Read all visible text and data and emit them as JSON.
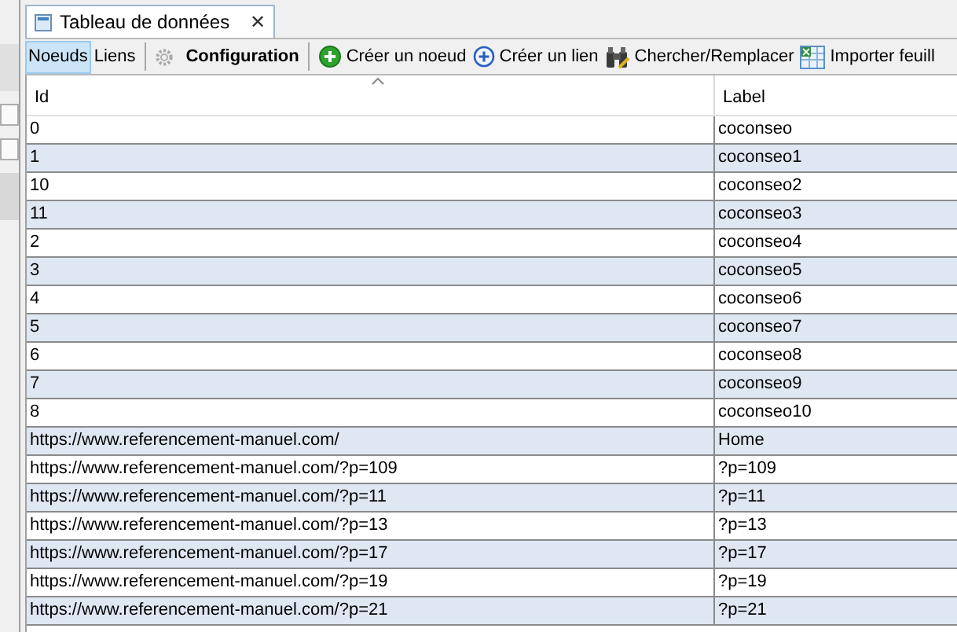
{
  "tab": {
    "title": "Tableau de données",
    "close": "✕"
  },
  "toolbar": {
    "views": [
      {
        "label": "Noeuds",
        "selected": true
      },
      {
        "label": "Liens",
        "selected": false
      }
    ],
    "actions": [
      {
        "kind": "gear",
        "label": "Configuration"
      },
      {
        "kind": "add-node",
        "label": "Créer un noeud"
      },
      {
        "kind": "add-link",
        "label": "Créer un lien"
      },
      {
        "kind": "binoculars",
        "label": "Chercher/Remplacer"
      },
      {
        "kind": "sheet",
        "label": "Importer feuill"
      }
    ]
  },
  "table": {
    "columns": [
      {
        "label": "Id",
        "sorted": true
      },
      {
        "label": "Label",
        "sorted": false
      }
    ],
    "rows": [
      [
        "0",
        "coconseo"
      ],
      [
        "1",
        "coconseo1"
      ],
      [
        "10",
        "coconseo2"
      ],
      [
        "11",
        "coconseo3"
      ],
      [
        "2",
        "coconseo4"
      ],
      [
        "3",
        "coconseo5"
      ],
      [
        "4",
        "coconseo6"
      ],
      [
        "5",
        "coconseo7"
      ],
      [
        "6",
        "coconseo8"
      ],
      [
        "7",
        "coconseo9"
      ],
      [
        "8",
        "coconseo10"
      ],
      [
        "https://www.referencement-manuel.com/",
        "Home"
      ],
      [
        "https://www.referencement-manuel.com/?p=109",
        "?p=109"
      ],
      [
        "https://www.referencement-manuel.com/?p=11",
        "?p=11"
      ],
      [
        "https://www.referencement-manuel.com/?p=13",
        "?p=13"
      ],
      [
        "https://www.referencement-manuel.com/?p=17",
        "?p=17"
      ],
      [
        "https://www.referencement-manuel.com/?p=19",
        "?p=19"
      ],
      [
        "https://www.referencement-manuel.com/?p=21",
        "?p=21"
      ]
    ]
  }
}
